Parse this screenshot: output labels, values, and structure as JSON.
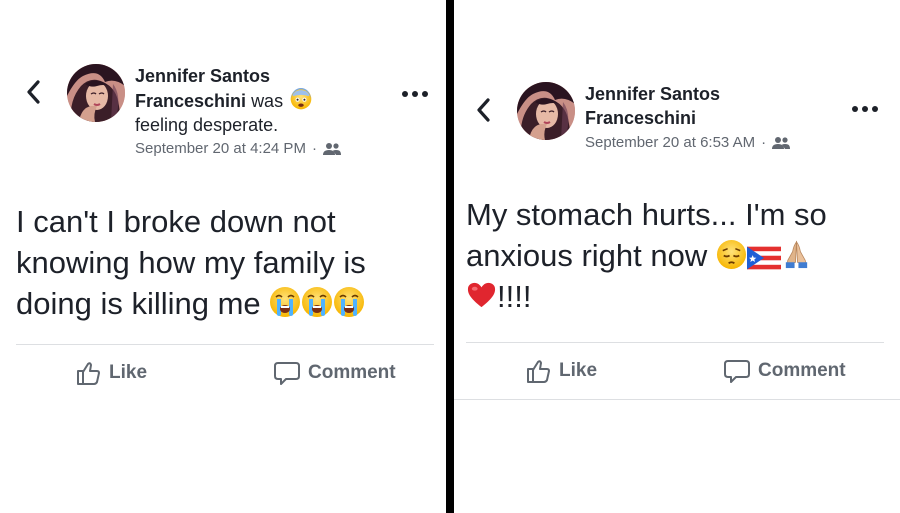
{
  "left_post": {
    "author_line1": "Jennifer Santos",
    "author_line2": "Franceschini",
    "was": "was",
    "feeling": "feeling desperate.",
    "timestamp": "September 20 at 4:24 PM",
    "dot": "·",
    "audience_icon": "friends-icon",
    "text_line1": "I can't I broke down not",
    "text_line2": "knowing how my family is",
    "text_line3": "doing is killing me",
    "like_label": "Like",
    "comment_label": "Comment"
  },
  "right_post": {
    "author_line1": "Jennifer Santos",
    "author_line2": "Franceschini",
    "timestamp": "September 20 at 6:53 AM",
    "dot": "·",
    "audience_icon": "friends-icon",
    "text_line1": "My stomach hurts... I'm so",
    "text_line2": "anxious right now",
    "text_line3": "!!!!",
    "like_label": "Like",
    "comment_label": "Comment"
  },
  "colors": {
    "text": "#1d2129",
    "meta": "#616770",
    "action": "#606770",
    "divider": "#000000",
    "separator": "#dddfe2"
  }
}
